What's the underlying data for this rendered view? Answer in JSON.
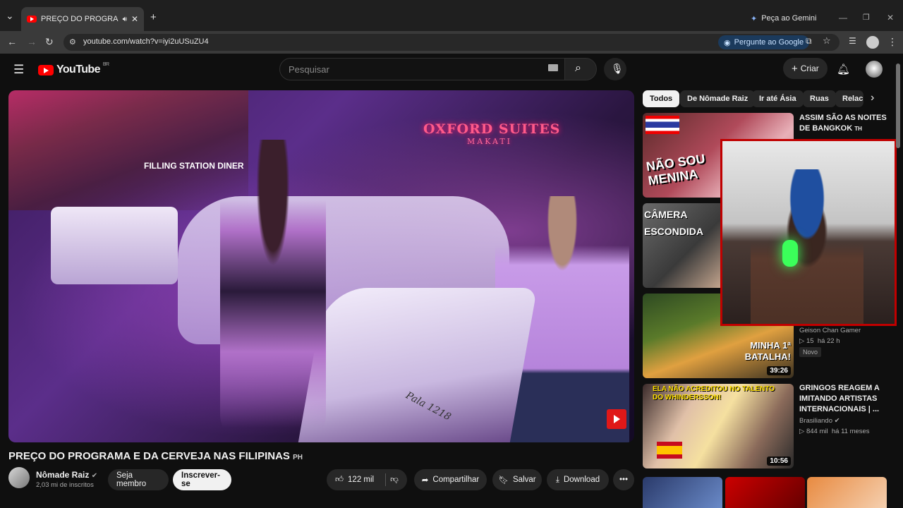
{
  "browser": {
    "tab_title": "PREÇO DO PROGRAMA E DA CERVEJA",
    "new_tab": "+",
    "gemini_button": "Peça ao Gemini",
    "url": "youtube.com/watch?v=iyi2uUSuZU4",
    "google_button": "Pergunte ao Google"
  },
  "youtube": {
    "logo_text": "YouTube",
    "region": "BR",
    "search_placeholder": "Pesquisar",
    "create_label": "Criar"
  },
  "video": {
    "title": "PREÇO DO PROGRAMA E DA CERVEJA NAS FILIPINAS",
    "title_suffix": "PH",
    "scene_sign_1": "OXFORD SUITES",
    "scene_sign_2": "MAKATI",
    "scene_sign_3": "FILLING STATION DINER",
    "scene_scooter_text": "Pala 1218",
    "channel": {
      "name": "Nômade Raiz",
      "subscribers": "2,03 mi de inscritos"
    },
    "actions": {
      "join": "Seja membro",
      "subscribe": "Inscrever-se",
      "likes": "122 mil",
      "share": "Compartilhar",
      "save": "Salvar",
      "download": "Download"
    }
  },
  "sidebar": {
    "chips": [
      "Todos",
      "De Nômade Raiz",
      "Ir até Ásia",
      "Ruas",
      "Relac"
    ],
    "recs": [
      {
        "title": "ASSIM SÃO AS NOITES DE BANGKOK",
        "suffix": "TH",
        "thumb_text": "NÃO SOU MENINA"
      },
      {
        "thumb_text": "CÂMERA ESCONDIDA"
      },
      {
        "channel": "Geison Chan Gamer",
        "views": "15",
        "age": "há 22 h",
        "badge": "Novo",
        "duration": "39:26",
        "thumb_text": "MINHA 1ª BATALHA!"
      },
      {
        "title": "GRINGOS REAGEM A IMITANDO ARTISTAS INTERNACIONAIS | ...",
        "channel": "Brasiliando",
        "views": "844 mil",
        "age": "há 11 meses",
        "duration": "10:56",
        "thumb_text": "ELA NÃO ACREDITOU NO TALENTO DO WHINDERSSON!"
      }
    ]
  }
}
